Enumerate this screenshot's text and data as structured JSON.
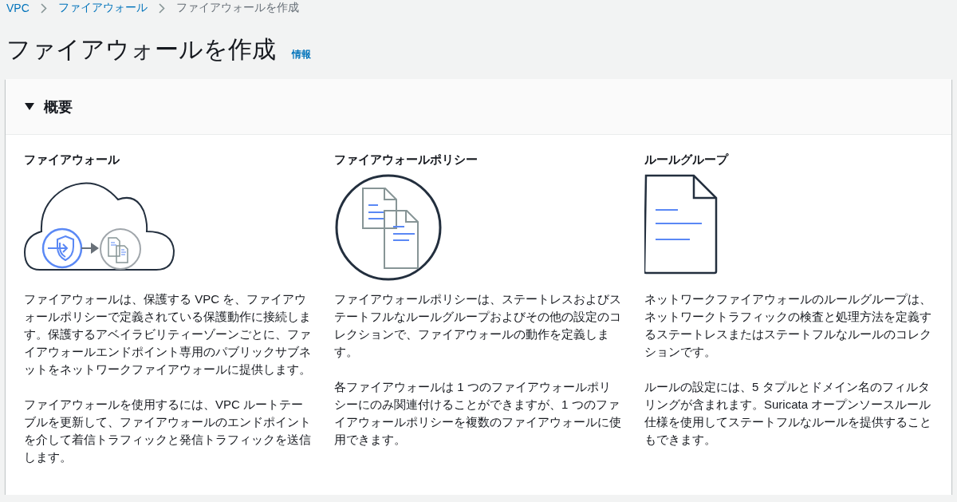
{
  "breadcrumbs": [
    {
      "label": "VPC",
      "link": true
    },
    {
      "label": "ファイアウォール",
      "link": true
    },
    {
      "label": "ファイアウォールを作成",
      "link": false
    }
  ],
  "page_title": "ファイアウォールを作成",
  "info_link": "情報",
  "overview": {
    "title": "概要",
    "expanded": true,
    "columns": [
      {
        "heading": "ファイアウォール",
        "kind": "cloud",
        "paragraphs": [
          "ファイアウォールは、保護する VPC を、ファイアウォールポリシーで定義されている保護動作に接続します。保護するアベイラビリティーゾーンごとに、ファイアウォールエンドポイント専用のパブリックサブネットをネットワークファイアウォールに提供します。",
          "ファイアウォールを使用するには、VPC ルートテーブルを更新して、ファイアウォールのエンドポイントを介して着信トラフィックと発信トラフィックを送信します。"
        ]
      },
      {
        "heading": "ファイアウォールポリシー",
        "kind": "policy",
        "paragraphs": [
          "ファイアウォールポリシーは、ステートレスおよびステートフルなルールグループおよびその他の設定のコレクションで、ファイアウォールの動作を定義します。",
          "各ファイアウォールは 1 つのファイアウォールポリシーにのみ関連付けることができますが、1 つのファイアウォールポリシーを複数のファイアウォールに使用できます。"
        ]
      },
      {
        "heading": "ルールグループ",
        "kind": "document",
        "paragraphs": [
          "ネットワークファイアウォールのルールグループは、ネットワークトラフィックの検査と処理方法を定義するステートレスまたはステートフルなルールのコレクションです。",
          "ルールの設定には、5 タプルとドメイン名のフィルタリングが含まれます。Suricata オープンソースルール仕様を使用してステートフルなルールを提供することもできます。"
        ]
      }
    ]
  }
}
